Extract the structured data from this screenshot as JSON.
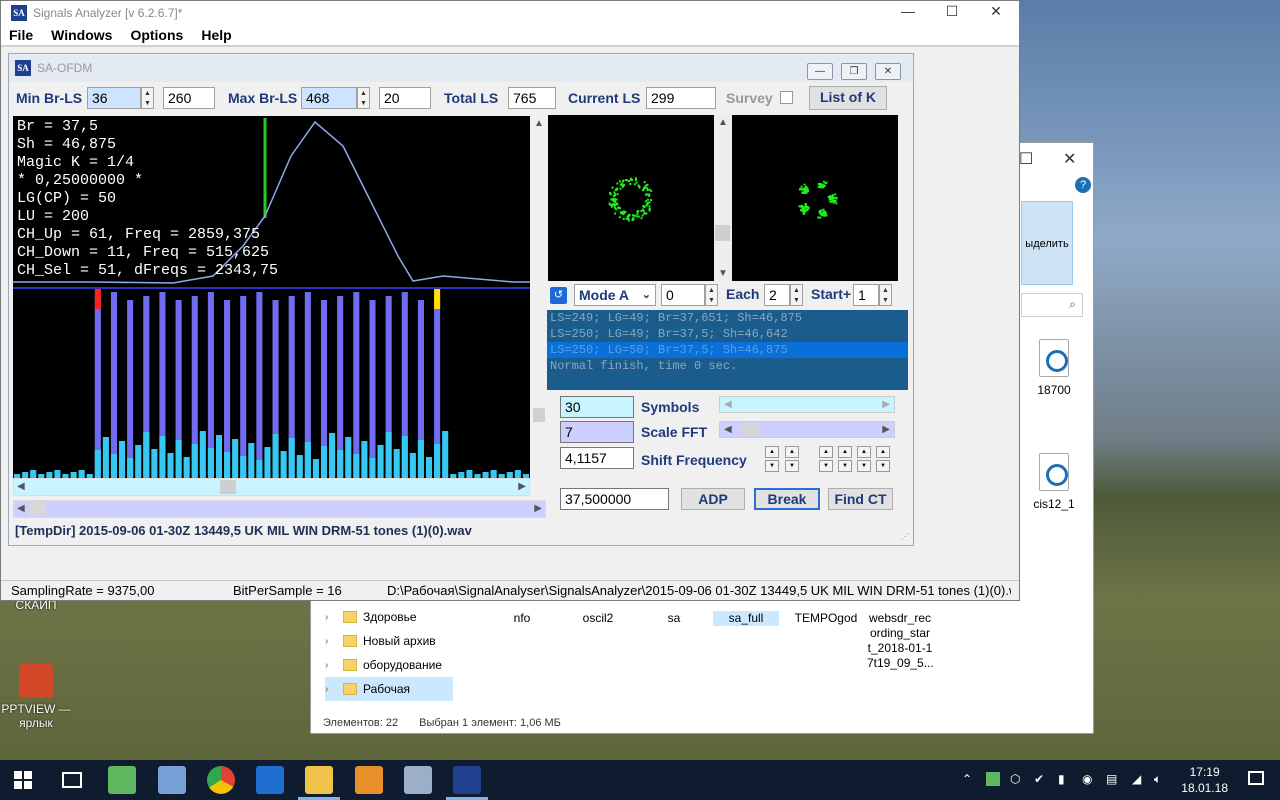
{
  "app": {
    "title": "Signals Analyzer [v 6.2.6.7]*",
    "logo_text": "SA",
    "menu": [
      "File",
      "Windows",
      "Options",
      "Help"
    ]
  },
  "child": {
    "title": "SA-OFDM",
    "min_br_ls_label": "Min Br-LS",
    "min_br_ls_value": "36",
    "min_br_ls_extra": "260",
    "max_br_ls_label": "Max Br-LS",
    "max_br_ls_value": "468",
    "max_br_ls_extra": "20",
    "total_ls_label": "Total LS",
    "total_ls_value": "765",
    "current_ls_label": "Current LS",
    "current_ls_value": "299",
    "survey_label": "Survey",
    "list_of_k_label": "List of K",
    "plot_text": "Br = 37,5\nSh = 46,875\nMagic K = 1/4\n* 0,25000000 *\nLG(CP) = 50\nLU = 200\nCH_Up = 61, Freq = 2859,375\nCH_Down = 11, Freq = 515,625\nCH_Sel = 51, dFreqs = 2343,75",
    "mode_value": "Mode A",
    "mode_num": "0",
    "each_label": "Each",
    "each_value": "2",
    "start_label": "Start+",
    "start_value": "1",
    "log": [
      "LS=249; LG=49; Br=37,651; Sh=46,875",
      "LS=250; LG=49; Br=37,5; Sh=46,642",
      "LS=250; LG=50; Br=37,5; Sh=46,875",
      "Normal finish, time 0 sec."
    ],
    "symbols_value": "30",
    "symbols_label": "Symbols",
    "scale_fft_value": "7",
    "scale_fft_label": "Scale FFT",
    "shift_freq_value": "4,1157",
    "shift_freq_label": "Shift Frequency",
    "freq_value": "37,500000",
    "adp_label": "ADP",
    "break_label": "Break",
    "find_ct_label": "Find CT",
    "file_path": "[TempDir] 2015-09-06 01-30Z 13449,5 UK MIL WIN DRM-51 tones (1)(0).wav"
  },
  "status": {
    "sampling_rate": "SamplingRate = 9375,00",
    "bits": "BitPerSample = 16",
    "path": "D:\\Рабочая\\SignalAnalyser\\SignalsAnalyzer\\2015-09-06 01-30Z 13449,5 UK MIL WIN DRM-51 tones (1)(0).wav"
  },
  "explorer": {
    "ribbon_button": "ыделить",
    "files_right": [
      "18700",
      "cis12_1"
    ],
    "files_bottom": [
      "nfo",
      "oscil2",
      "sa",
      "sa_full",
      "TEMPOgod",
      "websdr_rec ording_star t_2018-01-1 7t19_09_5..."
    ],
    "tree": [
      "Здоровье",
      "Новый архив",
      "оборудование",
      "Рабочая"
    ],
    "status_count": "Элементов: 22",
    "status_selected": "Выбран 1 элемент: 1,06 МБ"
  },
  "desktop": {
    "icons": [
      "СКАЙП",
      "PPTVIEW — ярлык"
    ]
  },
  "taskbar": {
    "time": "17:19",
    "date": "18.01.18"
  },
  "colors": {
    "bar_blue": "#6f6cf0",
    "bar_cyan": "#36c8f0",
    "marker_red": "#ff2020",
    "marker_yellow": "#ffe000",
    "green_line": "#22cc22",
    "constellation": "#22ee22"
  }
}
